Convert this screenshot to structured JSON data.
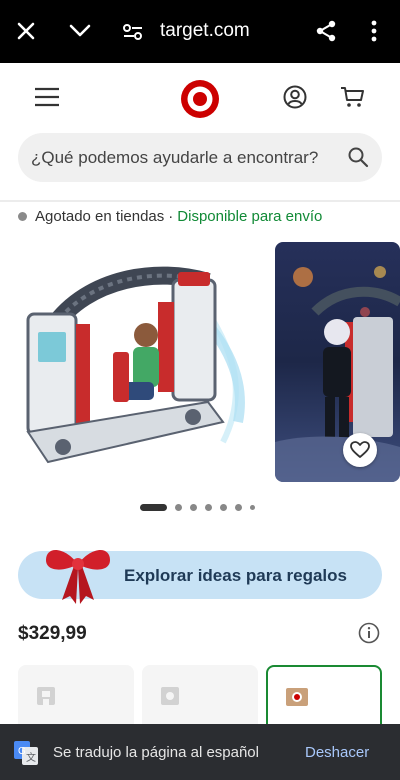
{
  "browser": {
    "url": "target.com"
  },
  "search": {
    "placeholder": "¿Qué podemos ayudarle a encontrar?"
  },
  "availability": {
    "store_status": "Agotado en tiendas",
    "separator": "·",
    "shipping_status": "Disponible para envío"
  },
  "carousel": {
    "image_count": 7,
    "active_index": 0
  },
  "promo": {
    "label": "Explorar ideas para regalos"
  },
  "product": {
    "price": "$329,99"
  },
  "translation_bar": {
    "message": "Se tradujo la página al español",
    "action_label": "Deshacer"
  },
  "colors": {
    "brand_red": "#cc0000",
    "available_green": "#118a36",
    "promo_blue": "#c7e2f5",
    "selected_border": "#1a8a33"
  },
  "icons": [
    "close-icon",
    "chevron-down-icon",
    "site-settings-icon",
    "share-icon",
    "more-vert-icon",
    "menu-icon",
    "target-logo",
    "account-icon",
    "cart-icon",
    "search-icon",
    "favorite-icon",
    "gift-bow-icon",
    "info-icon",
    "store-icon",
    "target-bag-icon",
    "translate-icon"
  ]
}
